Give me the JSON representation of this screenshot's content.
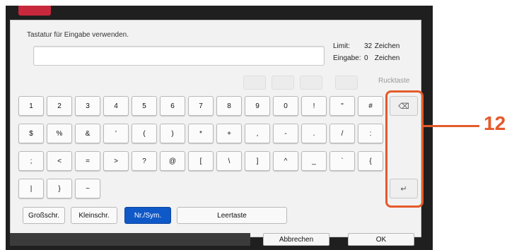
{
  "instruction_text": "Tastatur für Eingabe verwenden.",
  "limit": {
    "label": "Limit:",
    "value": "32",
    "unit": "Zeichen"
  },
  "input_count": {
    "label": "Eingabe:",
    "value": "0",
    "unit": "Zeichen"
  },
  "input_value": "",
  "backspace_label": "Rucktaste",
  "keys": {
    "row1": [
      "1",
      "2",
      "3",
      "4",
      "5",
      "6",
      "7",
      "8",
      "9",
      "0",
      "!",
      "\"",
      "#"
    ],
    "row2": [
      "$",
      "%",
      "&",
      "'",
      "(",
      ")",
      "*",
      "+",
      ",",
      "-",
      ".",
      "/",
      ":"
    ],
    "row3": [
      ";",
      "<",
      "=",
      ">",
      "?",
      "@",
      "[",
      "\\",
      "]",
      "^",
      "_",
      "`",
      "{"
    ],
    "row4": [
      "|",
      "}",
      "~"
    ]
  },
  "modes": {
    "upper": "Großschr.",
    "lower": "Kleinschr.",
    "numsym": "Nr./Sym.",
    "space": "Leertaste"
  },
  "actions": {
    "cancel": "Abbrechen",
    "ok": "OK"
  },
  "callout_number": "12",
  "colors": {
    "accent": "#e55a2b",
    "active_mode": "#0f58c8",
    "header_tab": "#c7283c"
  }
}
